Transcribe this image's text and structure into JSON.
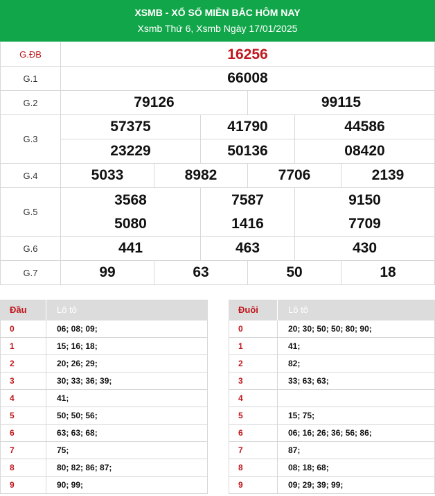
{
  "header": {
    "title": "XSMB - XỔ SỐ MIỀN BẮC HÔM NAY",
    "subtitle": "Xsmb Thứ 6, Xsmb Ngày 17/01/2025"
  },
  "prizes": [
    {
      "label": "G.ĐB",
      "numbers": [
        "16256"
      ]
    },
    {
      "label": "G.1",
      "numbers": [
        "66008"
      ]
    },
    {
      "label": "G.2",
      "numbers": [
        "79126",
        "99115"
      ]
    },
    {
      "label": "G.3",
      "numbers": [
        "57375",
        "41790",
        "44586",
        "23229",
        "50136",
        "08420"
      ]
    },
    {
      "label": "G.4",
      "numbers": [
        "5033",
        "8982",
        "7706",
        "2139"
      ]
    },
    {
      "label": "G.5",
      "numbers": [
        "3568",
        "7587",
        "9150",
        "5080",
        "1416",
        "7709"
      ]
    },
    {
      "label": "G.6",
      "numbers": [
        "441",
        "463",
        "430"
      ]
    },
    {
      "label": "G.7",
      "numbers": [
        "99",
        "63",
        "50",
        "18"
      ]
    }
  ],
  "loto_dau": {
    "col1": "Đầu",
    "col2": "Lô tô",
    "rows": [
      {
        "k": "0",
        "v": "06; 08; 09;"
      },
      {
        "k": "1",
        "v": "15; 16; 18;"
      },
      {
        "k": "2",
        "v": "20; 26; 29;"
      },
      {
        "k": "3",
        "v": "30; 33; 36; 39;"
      },
      {
        "k": "4",
        "v": "41;"
      },
      {
        "k": "5",
        "v": "50; 50; 56;"
      },
      {
        "k": "6",
        "v": "63; 63; 68;"
      },
      {
        "k": "7",
        "v": "75;"
      },
      {
        "k": "8",
        "v": "80; 82; 86; 87;"
      },
      {
        "k": "9",
        "v": "90; 99;"
      }
    ]
  },
  "loto_duoi": {
    "col1": "Đuôi",
    "col2": "Lô tô",
    "rows": [
      {
        "k": "0",
        "v": "20; 30; 50; 50; 80; 90;"
      },
      {
        "k": "1",
        "v": "41;"
      },
      {
        "k": "2",
        "v": "82;"
      },
      {
        "k": "3",
        "v": "33; 63; 63;"
      },
      {
        "k": "4",
        "v": ""
      },
      {
        "k": "5",
        "v": "15; 75;"
      },
      {
        "k": "6",
        "v": "06; 16; 26; 36; 56; 86;"
      },
      {
        "k": "7",
        "v": "87;"
      },
      {
        "k": "8",
        "v": "08; 18; 68;"
      },
      {
        "k": "9",
        "v": "09; 29; 39; 99;"
      }
    ]
  },
  "colors": {
    "header_bg": "#12a64a",
    "accent_red": "#c0171c"
  }
}
